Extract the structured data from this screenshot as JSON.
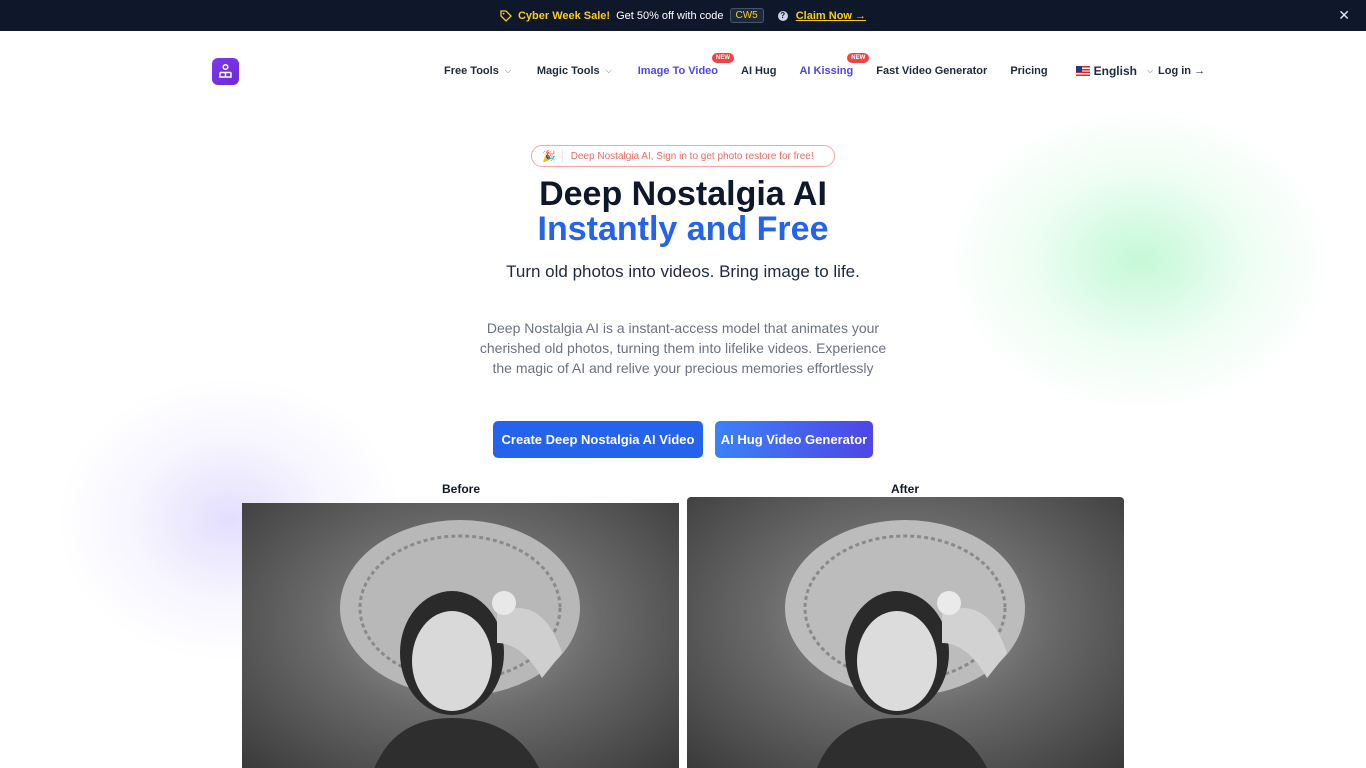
{
  "banner": {
    "sale": "Cyber Week Sale!",
    "offer": "Get 50% off with code",
    "code": "CW5",
    "claim": "Claim Now →"
  },
  "nav": {
    "items": [
      {
        "label": "Free Tools",
        "dropdown": true
      },
      {
        "label": "Magic Tools",
        "dropdown": true
      },
      {
        "label": "Image To Video",
        "badge": "NEW"
      },
      {
        "label": "AI Hug"
      },
      {
        "label": "AI Kissing",
        "badge": "NEW"
      },
      {
        "label": "Fast Video Generator"
      },
      {
        "label": "Pricing"
      }
    ],
    "language": "English",
    "login": "Log in →"
  },
  "hero": {
    "pill_icon": "🎉",
    "pill": "Deep Nostalgia AI, Sign in to get photo restore for free!",
    "title_line1": "Deep Nostalgia AI",
    "title_line2": "Instantly and Free",
    "tagline": "Turn old photos into videos. Bring image to life.",
    "description": "Deep Nostalgia AI is a instant-access model that animates your cherished old photos, turning them into lifelike videos. Experience the magic of AI and relive your precious memories effortlessly",
    "primary_button": "Create Deep Nostalgia AI Video",
    "secondary_button": "AI Hug Video Generator"
  },
  "comparison": {
    "before_label": "Before",
    "after_label": "After"
  },
  "colors": {
    "banner_bg": "#0f172a",
    "accent_yellow": "#facc15",
    "brand_blue": "#2563eb",
    "brand_purple": "#7c3aed",
    "badge_red": "#ef4444"
  },
  "icons": [
    "tag-icon",
    "help-icon",
    "close-icon",
    "logo-icon",
    "chevron-down-icon",
    "flag-us-icon",
    "party-icon"
  ]
}
